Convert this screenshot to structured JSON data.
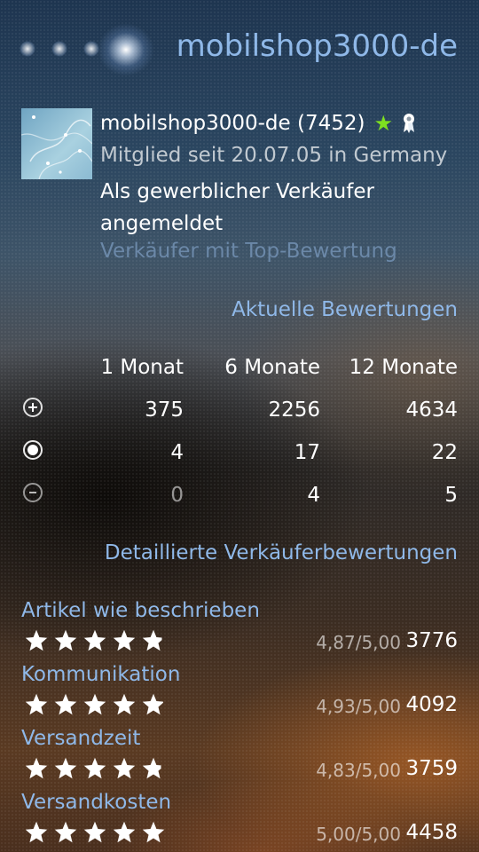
{
  "header": {
    "title": "mobilshop3000-de"
  },
  "seller": {
    "name": "mobilshop3000-de (7452)",
    "member_since": "Mitglied seit 20.07.05 in Germany",
    "business_status": "Als gewerblicher Verkäufer angemeldet",
    "top_rated": "Verkäufer mit Top-Bewertung",
    "avatar_icon": "seller-avatar-image",
    "badges": [
      "green-star-icon",
      "top-rated-ribbon-icon"
    ]
  },
  "current_ratings": {
    "title": "Aktuelle Bewertungen",
    "columns": [
      "1 Monat",
      "6 Monate",
      "12 Monate"
    ],
    "rows": [
      {
        "icon": "positive-icon",
        "values": [
          "375",
          "2256",
          "4634"
        ]
      },
      {
        "icon": "neutral-icon",
        "values": [
          "4",
          "17",
          "22"
        ]
      },
      {
        "icon": "negative-icon",
        "values": [
          "0",
          "4",
          "5"
        ]
      }
    ]
  },
  "detailed_ratings": {
    "title": "Detaillierte Verkäuferbewertungen",
    "items": [
      {
        "label": "Artikel wie beschrieben",
        "stars": 4.87,
        "ratio": "4,87/5,00",
        "count": "3776"
      },
      {
        "label": "Kommunikation",
        "stars": 4.93,
        "ratio": "4,93/5,00",
        "count": "4092"
      },
      {
        "label": "Versandzeit",
        "stars": 4.83,
        "ratio": "4,83/5,00",
        "count": "3759"
      },
      {
        "label": "Versandkosten",
        "stars": 5.0,
        "ratio": "5,00/5,00",
        "count": "4458"
      }
    ]
  },
  "colors": {
    "accent": "#8fb8e8",
    "star_badge": "#7ee020"
  }
}
